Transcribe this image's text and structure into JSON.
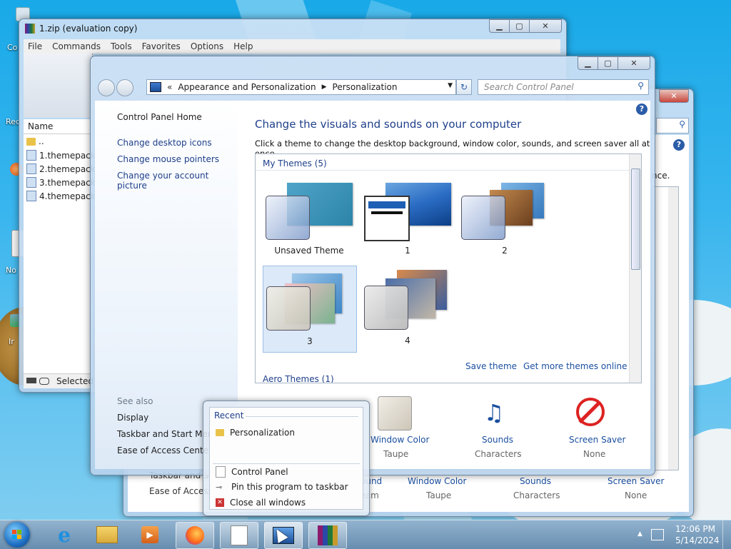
{
  "desktop": {
    "icon_labels": [
      "Co",
      "Rec",
      "No",
      "Ir"
    ]
  },
  "zip_window": {
    "title": "1.zip (evaluation copy)",
    "menu": [
      "File",
      "Commands",
      "Tools",
      "Favorites",
      "Options",
      "Help"
    ],
    "column_name": "Name",
    "files": [
      "..",
      "1.themepack",
      "2.themepack",
      "3.themepack",
      "4.themepack"
    ],
    "status": "Selected"
  },
  "back_window": {
    "text_partial": "nce.",
    "sidebar_partial": [
      "Taskbar and S",
      "Ease of Access"
    ],
    "bottom_links": [
      "Window Color",
      "Sounds",
      "Screen Saver"
    ],
    "bottom_values": [
      "Taupe",
      "Characters",
      "None"
    ],
    "partial_label": "ound",
    "partial_value": "tream"
  },
  "cp_window": {
    "breadcrumb_prefix": "«",
    "breadcrumb": [
      "Appearance and Personalization",
      "Personalization"
    ],
    "search_placeholder": "Search Control Panel",
    "left_links": [
      "Control Panel Home",
      "Change desktop icons",
      "Change mouse pointers",
      "Change your account picture"
    ],
    "see_also_heading": "See also",
    "see_also": [
      "Display",
      "Taskbar and Start Menu",
      "Ease of Access Center"
    ],
    "heading": "Change the visuals and sounds on your computer",
    "subheading": "Click a theme to change the desktop background, window color, sounds, and screen saver all at once.",
    "my_themes_label": "My Themes (5)",
    "themes": [
      "Unsaved Theme",
      "1",
      "2",
      "3",
      "4"
    ],
    "save_theme": "Save theme",
    "get_more": "Get more themes online",
    "aero_label": "Aero Themes (1)",
    "bottom_items": [
      {
        "label": "Window Color",
        "value": "Taupe"
      },
      {
        "label": "Sounds",
        "value": "Characters"
      },
      {
        "label": "Screen Saver",
        "value": "None"
      }
    ]
  },
  "jump_list": {
    "recent_heading": "Recent",
    "recent_items": [
      "Personalization"
    ],
    "tasks": [
      "Control Panel",
      "Pin this program to taskbar",
      "Close all windows"
    ]
  },
  "taskbar": {
    "time": "12:06 PM",
    "date": "5/14/2024"
  }
}
